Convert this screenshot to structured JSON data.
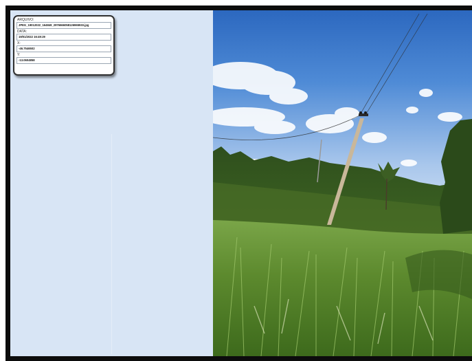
{
  "info_panel": {
    "arquivo_label": "ARQUIVO:",
    "arquivo_value": "JPEG_19012022_164849_2976666058126965933.jpg",
    "data_label": "DATA:",
    "data_value": "19/01/2022 16:49:29",
    "x_label": "X:",
    "x_value": "-46.7546502",
    "y_label": "Y:",
    "y_value": "-13.0604858"
  },
  "colors": {
    "panel_bg": "#d8e5f5",
    "frame": "#0c0c0c",
    "sky_top": "#2f6fc4",
    "sky_bottom": "#bcd4ef",
    "grass": "#5f8f2c"
  }
}
